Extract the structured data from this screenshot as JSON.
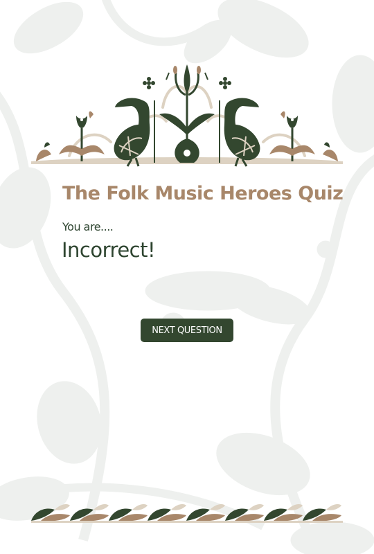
{
  "quiz": {
    "title": "The Folk Music Heroes Quiz",
    "result_prefix": "You are....",
    "result_value": "Incorrect!",
    "next_button_label": "NEXT QUESTION"
  },
  "colors": {
    "title": "#a8876a",
    "text_dark_green": "#2e4530",
    "button_bg": "#33472f",
    "button_text": "#ffffff",
    "ornament_green": "#33472f",
    "ornament_tan": "#a8876a",
    "ornament_beige": "#ddd2c2",
    "background_pattern": "#eef0ee"
  }
}
